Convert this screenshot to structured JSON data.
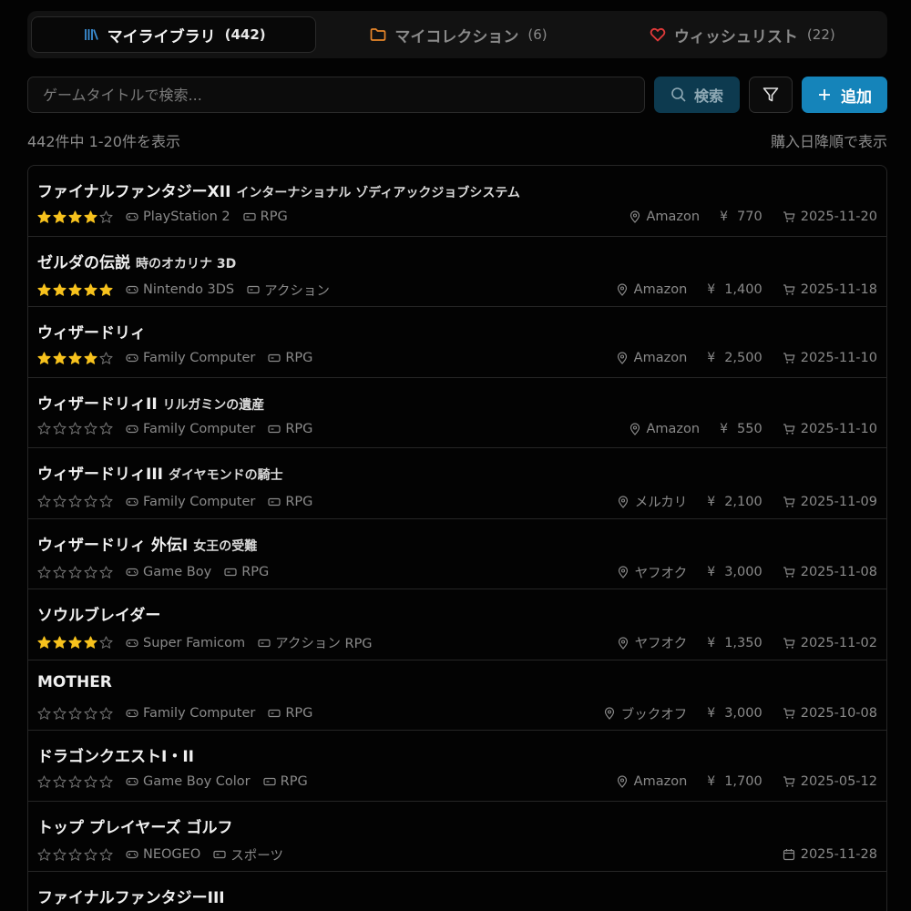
{
  "tabs": [
    {
      "label": "マイライブラリ",
      "count": "(442)",
      "icon": "library-icon",
      "color": "#3b8fd6"
    },
    {
      "label": "マイコレクション",
      "count": "(6)",
      "icon": "folder-icon",
      "color": "#e8862a"
    },
    {
      "label": "ウィッシュリスト",
      "count": "(22)",
      "icon": "heart-icon",
      "color": "#e23a3a"
    }
  ],
  "search": {
    "placeholder": "ゲームタイトルで検索...",
    "value": "",
    "button_label": "検索"
  },
  "add_label": "追加",
  "summary": {
    "range": "442件中 1-20件を表示",
    "sort": "購入日降順で表示"
  },
  "games": [
    {
      "title": "ファイナルファンタジーXII",
      "subtitle": "インターナショナル ゾディアックジョブシステム",
      "rating": 4,
      "platform": "PlayStation 2",
      "genre": "RPG",
      "store": "Amazon",
      "price": "770",
      "date": "2025-11-20",
      "date_icon": "cart-icon"
    },
    {
      "title": "ゼルダの伝説",
      "subtitle": "時のオカリナ 3D",
      "rating": 5,
      "platform": "Nintendo 3DS",
      "genre": "アクション",
      "store": "Amazon",
      "price": "1,400",
      "date": "2025-11-18",
      "date_icon": "cart-icon"
    },
    {
      "title": "ウィザードリィ",
      "subtitle": "",
      "rating": 4,
      "platform": "Family Computer",
      "genre": "RPG",
      "store": "Amazon",
      "price": "2,500",
      "date": "2025-11-10",
      "date_icon": "cart-icon"
    },
    {
      "title": "ウィザードリィII",
      "subtitle": "リルガミンの遺産",
      "rating": 0,
      "platform": "Family Computer",
      "genre": "RPG",
      "store": "Amazon",
      "price": "550",
      "date": "2025-11-10",
      "date_icon": "cart-icon"
    },
    {
      "title": "ウィザードリィIII",
      "subtitle": "ダイヤモンドの騎士",
      "rating": 0,
      "platform": "Family Computer",
      "genre": "RPG",
      "store": "メルカリ",
      "price": "2,100",
      "date": "2025-11-09",
      "date_icon": "cart-icon"
    },
    {
      "title": "ウィザードリィ 外伝I",
      "subtitle": "女王の受難",
      "rating": 0,
      "platform": "Game Boy",
      "genre": "RPG",
      "store": "ヤフオク",
      "price": "3,000",
      "date": "2025-11-08",
      "date_icon": "cart-icon"
    },
    {
      "title": "ソウルブレイダー",
      "subtitle": "",
      "rating": 4,
      "platform": "Super Famicom",
      "genre": "アクション RPG",
      "store": "ヤフオク",
      "price": "1,350",
      "date": "2025-11-02",
      "date_icon": "cart-icon"
    },
    {
      "title": "MOTHER",
      "subtitle": "",
      "rating": 0,
      "platform": "Family Computer",
      "genre": "RPG",
      "store": "ブックオフ",
      "price": "3,000",
      "date": "2025-10-08",
      "date_icon": "cart-icon"
    },
    {
      "title": "ドラゴンクエストI・II",
      "subtitle": "",
      "rating": 0,
      "platform": "Game Boy Color",
      "genre": "RPG",
      "store": "Amazon",
      "price": "1,700",
      "date": "2025-05-12",
      "date_icon": "cart-icon"
    },
    {
      "title": "トップ プレイヤーズ ゴルフ",
      "subtitle": "",
      "rating": 0,
      "platform": "NEOGEO",
      "genre": "スポーツ",
      "store": "",
      "price": "",
      "date": "2025-11-28",
      "date_icon": "calendar-icon"
    },
    {
      "title": "ファイナルファンタジーIII",
      "subtitle": "",
      "rating": 0,
      "platform": "",
      "genre": "",
      "store": "",
      "price": "",
      "date": "",
      "date_icon": "cart-icon"
    }
  ],
  "colors": {
    "star_filled": "#f7c21d",
    "star_empty": "#6f6f6f",
    "accent": "#1584ba"
  }
}
